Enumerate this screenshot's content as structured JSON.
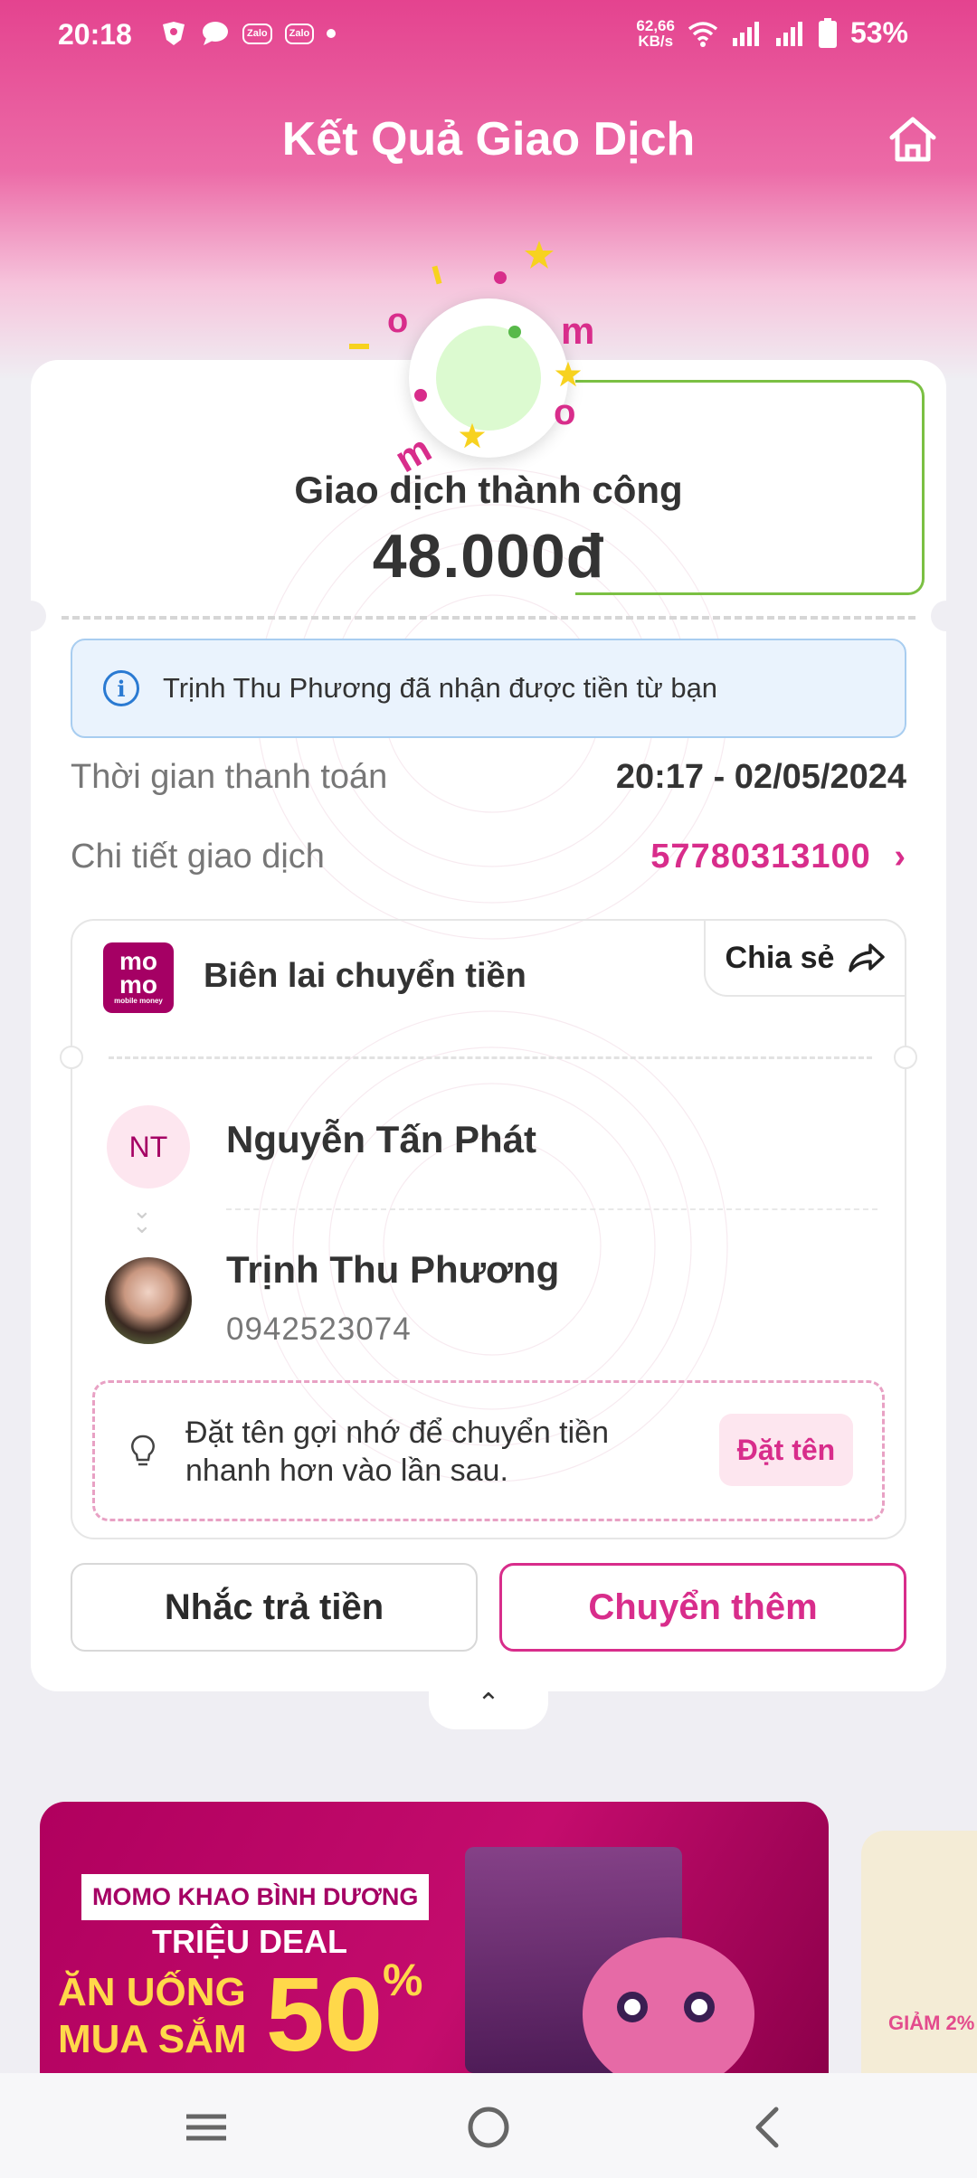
{
  "status_bar": {
    "time": "20:18",
    "net_speed_value": "62,66",
    "net_speed_unit": "KB/s",
    "battery": "53%",
    "zalo_label": "Zalo"
  },
  "header": {
    "title": "Kết Quả Giao Dịch"
  },
  "result": {
    "status": "Giao dịch thành công",
    "amount": "48.000đ"
  },
  "info_notice": "Trịnh Thu Phương đã nhận được tiền từ bạn",
  "details": {
    "time_label": "Thời gian thanh toán",
    "time_value": "20:17 - 02/05/2024",
    "txn_label": "Chi tiết giao dịch",
    "txn_value": "57780313100"
  },
  "receipt": {
    "logo_line1": "mo",
    "logo_line2": "mo",
    "logo_small": "mobile money",
    "title": "Biên lai chuyển tiền",
    "share_label": "Chia sẻ",
    "sender_initials": "NT",
    "sender_name": "Nguyễn Tấn Phát",
    "receiver_name": "Trịnh Thu Phương",
    "receiver_phone": "0942523074",
    "nickname_hint": "Đặt tên gợi nhớ để chuyển tiền nhanh hơn vào lần sau.",
    "nickname_button": "Đặt tên"
  },
  "actions": {
    "remind": "Nhắc trả tiền",
    "transfer_more": "Chuyển thêm"
  },
  "banner": {
    "tag": "MOMO KHAO BÌNH DƯƠNG",
    "line1": "TRIỆU DEAL",
    "line2": "ĂN UỐNG",
    "line3": "MUA SẮM",
    "percent": "50",
    "percent_sign": "%",
    "side_text": "GIẢM 2%"
  },
  "colors": {
    "brand": "#d82d8b",
    "momo": "#a50064",
    "success_green": "#7bc043",
    "info_blue": "#2a7ad2"
  }
}
